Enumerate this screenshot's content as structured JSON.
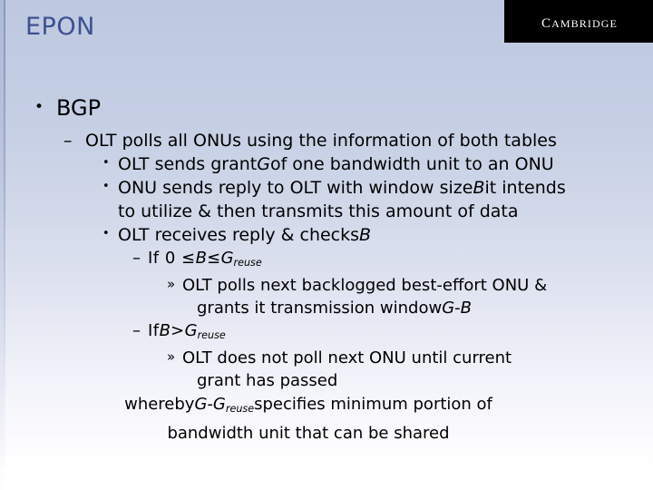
{
  "slide": {
    "title": "EPON",
    "title_color": "#3c5192",
    "background_top_color": "#bdc8e0",
    "background_bottom_color": "#ffffff"
  },
  "logo": {
    "text": "CAMBRIDGE",
    "background_color": "#000000",
    "text_color": "#ffffff"
  },
  "bullets": {
    "l1_glyph": "•",
    "l2_glyph": "–",
    "l3_glyph": "•",
    "l4_glyph": "–",
    "l5_glyph": "»"
  },
  "content": {
    "heading": "BGP",
    "line_polls": "OLT polls all ONUs using the information of both tables",
    "line_grant_a": "OLT sends grant ",
    "line_grant_var": "G",
    "line_grant_b": " of one bandwidth unit to an ONU",
    "line_reply_a": "ONU sends reply to OLT with window size ",
    "line_reply_var": "B",
    "line_reply_b": " it intends",
    "line_reply_wrap": "to utilize & then transmits this amount of data",
    "line_receives_a": "OLT receives reply & checks ",
    "line_receives_var": "B",
    "cond1_prefix": "If 0 ≤ ",
    "cond1_var1": "B",
    "cond1_mid": " ≤ ",
    "cond1_var2": "G",
    "cond1_sub": "reuse",
    "sub1_a": "OLT polls next backlogged best-effort ONU &",
    "sub1_wrap_a": "grants it transmission window ",
    "sub1_wrap_var1": "G",
    "sub1_wrap_mid": " - ",
    "sub1_wrap_var2": "B",
    "cond2_prefix": "If ",
    "cond2_var1": "B",
    "cond2_mid": " > ",
    "cond2_var2": "G",
    "cond2_sub": "reuse",
    "sub2_a": "OLT does not poll next ONU until current",
    "sub2_wrap": "grant has passed",
    "whereby_a": "whereby ",
    "whereby_var1": "G",
    "whereby_mid": " - ",
    "whereby_var2": "G",
    "whereby_sub": "reuse",
    "whereby_b": " specifies minimum portion of",
    "whereby_wrap": "bandwidth unit that can be shared"
  }
}
